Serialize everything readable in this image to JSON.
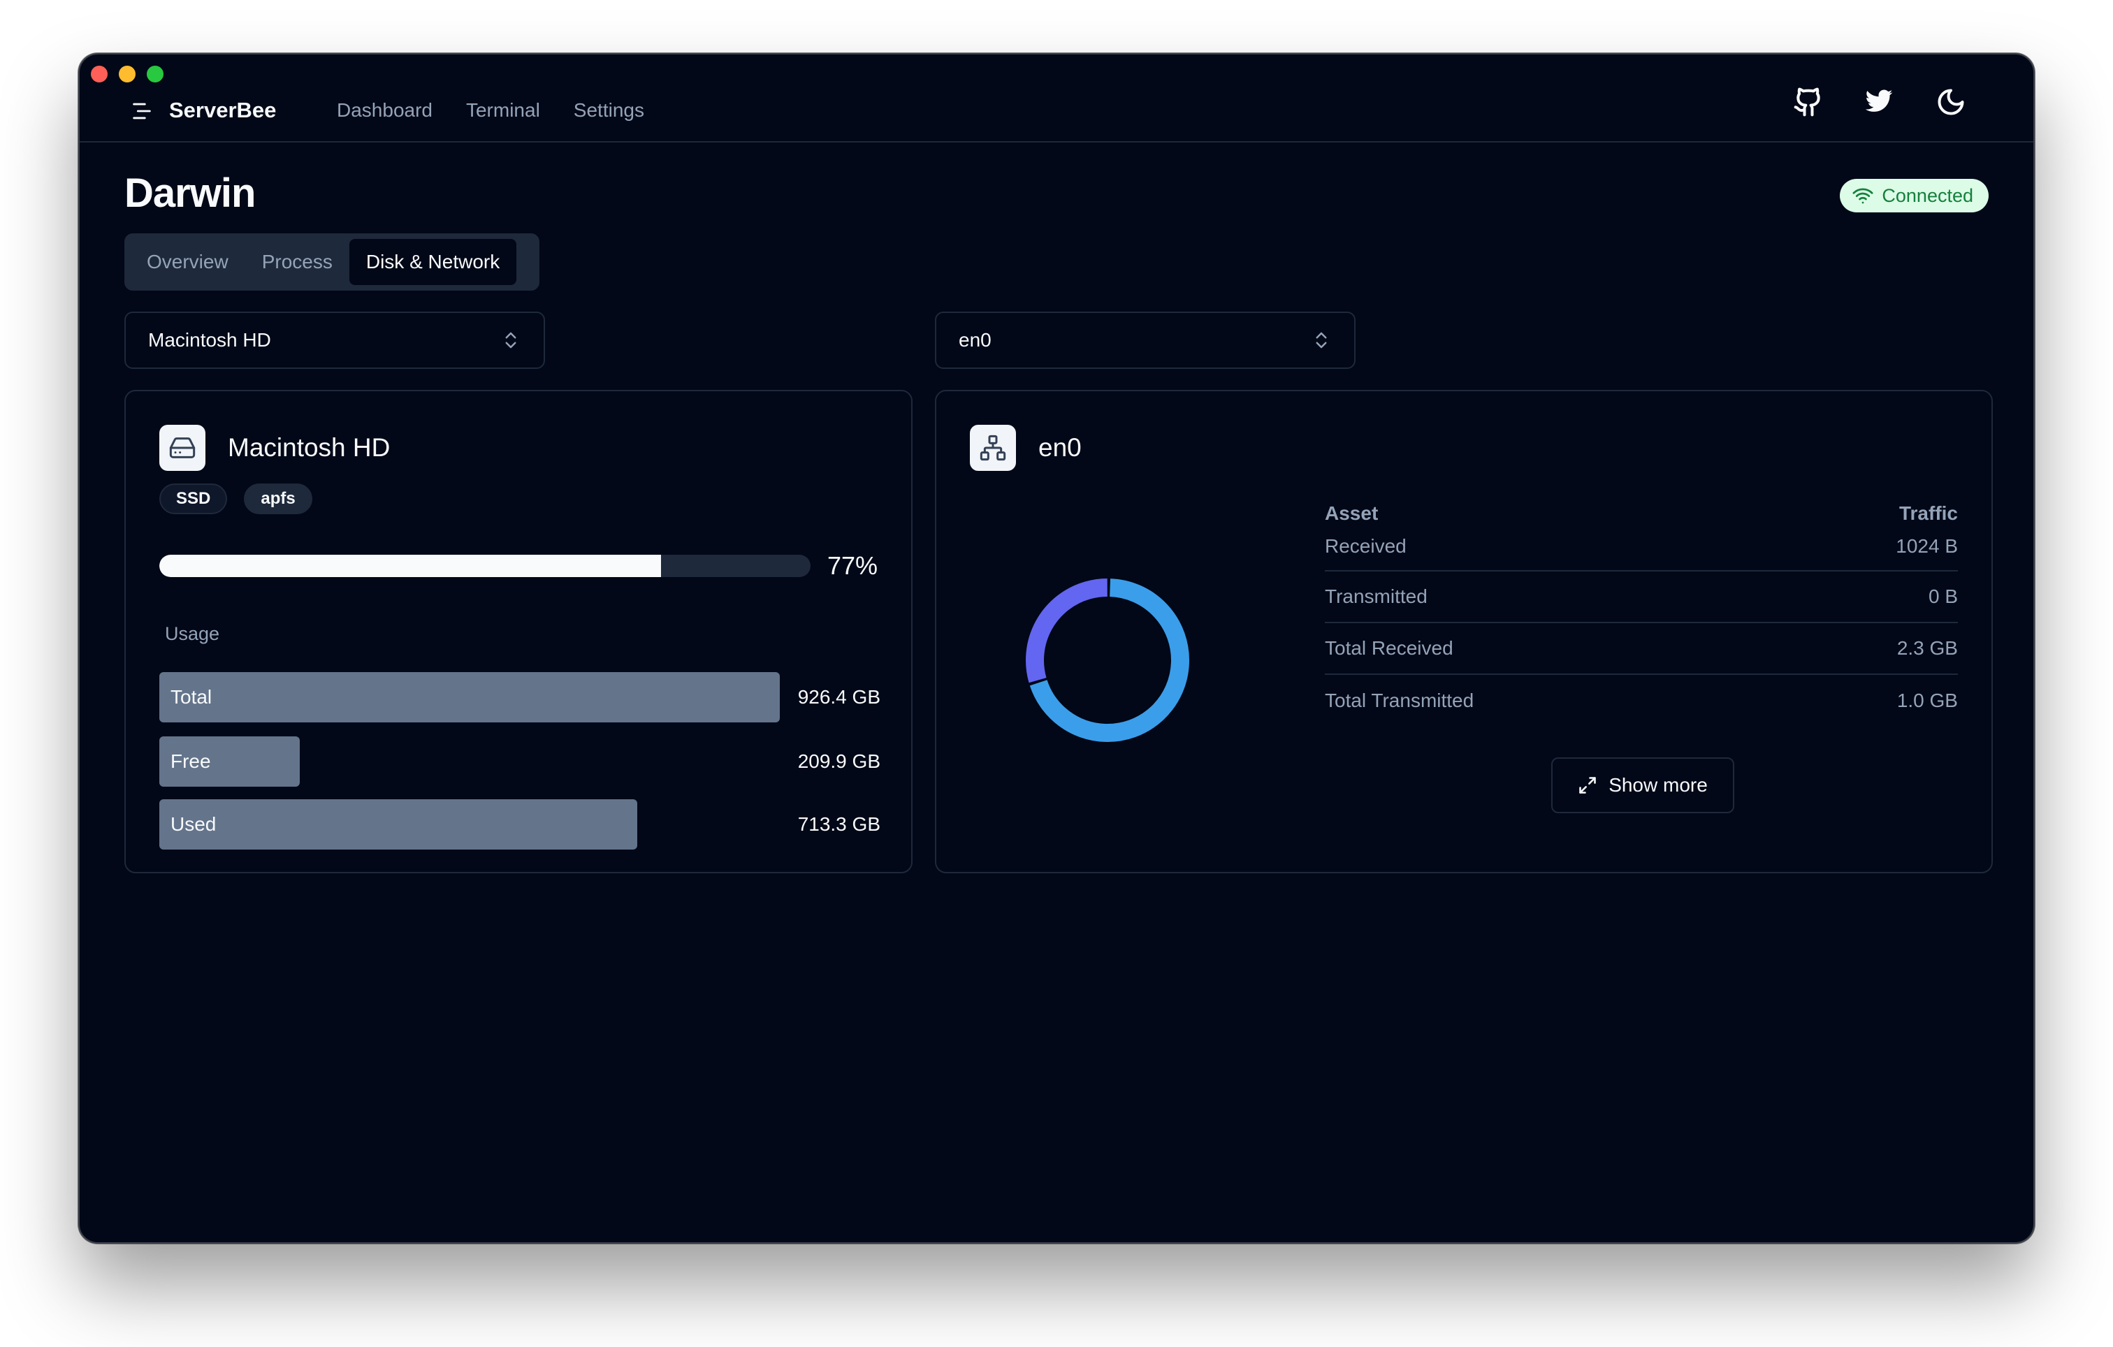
{
  "window": {
    "controls": [
      "close",
      "minimize",
      "zoom"
    ]
  },
  "header": {
    "brand": "ServerBee",
    "nav": [
      "Dashboard",
      "Terminal",
      "Settings"
    ],
    "icons": [
      "github-icon",
      "twitter-icon",
      "moon-icon"
    ]
  },
  "page": {
    "title": "Darwin",
    "status": "Connected",
    "tabs": [
      {
        "label": "Overview",
        "active": false
      },
      {
        "label": "Process",
        "active": false
      },
      {
        "label": "Disk & Network",
        "active": true
      }
    ]
  },
  "disk_select": {
    "value": "Macintosh HD"
  },
  "net_select": {
    "value": "en0"
  },
  "disk_card": {
    "title": "Macintosh HD",
    "tags": [
      "SSD",
      "apfs"
    ],
    "usage_percent": 77,
    "usage_percent_label": "77%",
    "usage_label": "Usage",
    "rows": [
      {
        "label": "Total",
        "value": "926.4 GB",
        "gb": 926.4
      },
      {
        "label": "Free",
        "value": "209.9 GB",
        "gb": 209.9
      },
      {
        "label": "Used",
        "value": "713.3 GB",
        "gb": 713.3
      }
    ]
  },
  "net_card": {
    "title": "en0",
    "table": {
      "headers": [
        "Asset",
        "Traffic"
      ],
      "rows": [
        [
          "Received",
          "1024 B"
        ],
        [
          "Transmitted",
          "0 B"
        ],
        [
          "Total Received",
          "2.3 GB"
        ],
        [
          "Total Transmitted",
          "1.0 GB"
        ]
      ]
    },
    "donut_fractions": [
      0.7,
      0.3
    ],
    "show_more": "Show more"
  },
  "colors": {
    "background": "#020817",
    "border": "#1e293b",
    "bar": "#64748b",
    "muted_text": "#94a3b8",
    "donut_primary": "#3b9eea",
    "donut_secondary": "#6366f1",
    "status_bg": "#dcfce7",
    "status_text": "#15803d"
  }
}
